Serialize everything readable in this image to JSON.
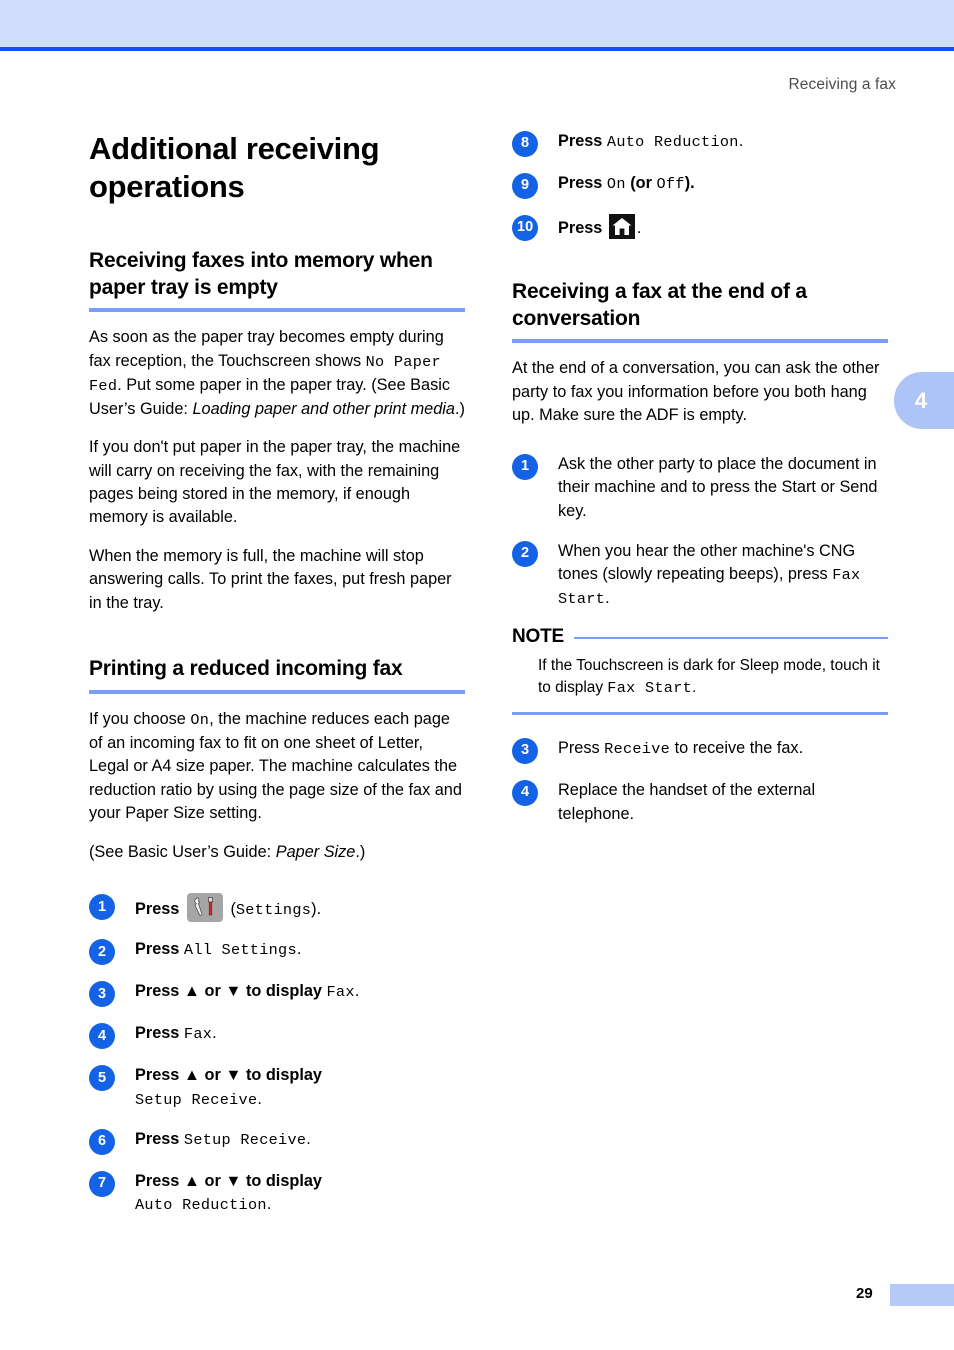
{
  "header": {
    "running_head": "Receiving a fax"
  },
  "chapter_tab": {
    "number": "4"
  },
  "footer": {
    "page_number": "29"
  },
  "left_column": {
    "chapter_title": "Additional receiving operations",
    "section1": {
      "title": "Receiving faxes into memory when paper tray is empty",
      "para1_a": "As soon as the paper tray becomes empty during fax reception, the Touchscreen shows ",
      "para1_mono": "No Paper Fed",
      "para1_b": ". Put some paper in the paper tray. (See Basic User’s Guide: ",
      "para1_italic": "Loading paper and other print media",
      "para1_c": ".)",
      "para2": "If you don't put paper in the paper tray, the machine will carry on receiving the fax, with the remaining pages being stored in the memory, if enough memory is available.",
      "para3": "When the memory is full, the machine will stop answering calls. To print the faxes, put fresh paper in the tray."
    },
    "section2": {
      "title": "Printing a reduced incoming fax",
      "para1_a": "If you choose ",
      "para1_mono": "On",
      "para1_b": ", the machine reduces each page of an incoming fax to fit on one sheet of Letter, Legal or A4 size paper. The machine calculates the reduction ratio by using the page size of the fax and your Paper Size setting.",
      "para2_a": "(See Basic User’s Guide: ",
      "para2_italic": "Paper Size",
      "para2_b": ".)",
      "steps": [
        {
          "num": "1",
          "press_label": "Press",
          "icon": "settings-icon",
          "suffix": "(Settings)."
        },
        {
          "num": "2",
          "press_label": "Press",
          "mono": "All Settings",
          "suffix": "."
        },
        {
          "num": "3",
          "press_label": "Press ▲ or ▼ to display",
          "mono": "Fax",
          "suffix": "."
        },
        {
          "num": "4",
          "press_label": "Press",
          "mono": "Fax",
          "suffix": "."
        },
        {
          "num": "5",
          "press_label": "Press ▲ or ▼ to display",
          "mono": "Setup Receive",
          "suffix": ".",
          "wrap": true
        },
        {
          "num": "6",
          "press_label": "Press",
          "mono": "Setup Receive",
          "suffix": "."
        },
        {
          "num": "7",
          "press_label": "Press ▲ or ▼ to display",
          "mono": "Auto Reduction",
          "suffix": ".",
          "wrap": true
        }
      ]
    }
  },
  "right_column": {
    "steps_continued": [
      {
        "num": "8",
        "press_label": "Press",
        "mono": "Auto Reduction",
        "suffix": "."
      },
      {
        "num": "9",
        "press_label": "Press",
        "mono": "On",
        "mid": " (or ",
        "mono2": "Off",
        "suffix": ")."
      },
      {
        "num": "10",
        "press_label": "Press",
        "icon": "home-icon",
        "suffix": "."
      }
    ],
    "section3": {
      "title": "Receiving a fax at the end of a conversation",
      "intro": "At the end of a conversation, you can ask the other party to fax you information before you both hang up. Make sure the ADF is empty.",
      "steps_a": [
        {
          "num": "1",
          "text": "Ask the other party to place the document in their machine and to press the Start or Send key."
        },
        {
          "num": "2",
          "text_a": "When you hear the other machine's CNG tones (slowly repeating beeps), press ",
          "mono": "Fax Start",
          "text_b": "."
        }
      ],
      "note": {
        "label": "NOTE",
        "body_a": "If the Touchscreen is dark for Sleep mode, touch it to display ",
        "body_mono": "Fax Start",
        "body_b": "."
      },
      "steps_b": [
        {
          "num": "3",
          "text_a": "Press ",
          "mono": "Receive",
          "text_b": " to receive the fax."
        },
        {
          "num": "4",
          "text": "Replace the handset of the external telephone."
        }
      ]
    }
  },
  "colors": {
    "band": "#cfdcfb",
    "rule": "#0a54ef",
    "heading_underline": "#7b9dfb",
    "badge": "#1463e6",
    "tab": "#aec4f7"
  }
}
